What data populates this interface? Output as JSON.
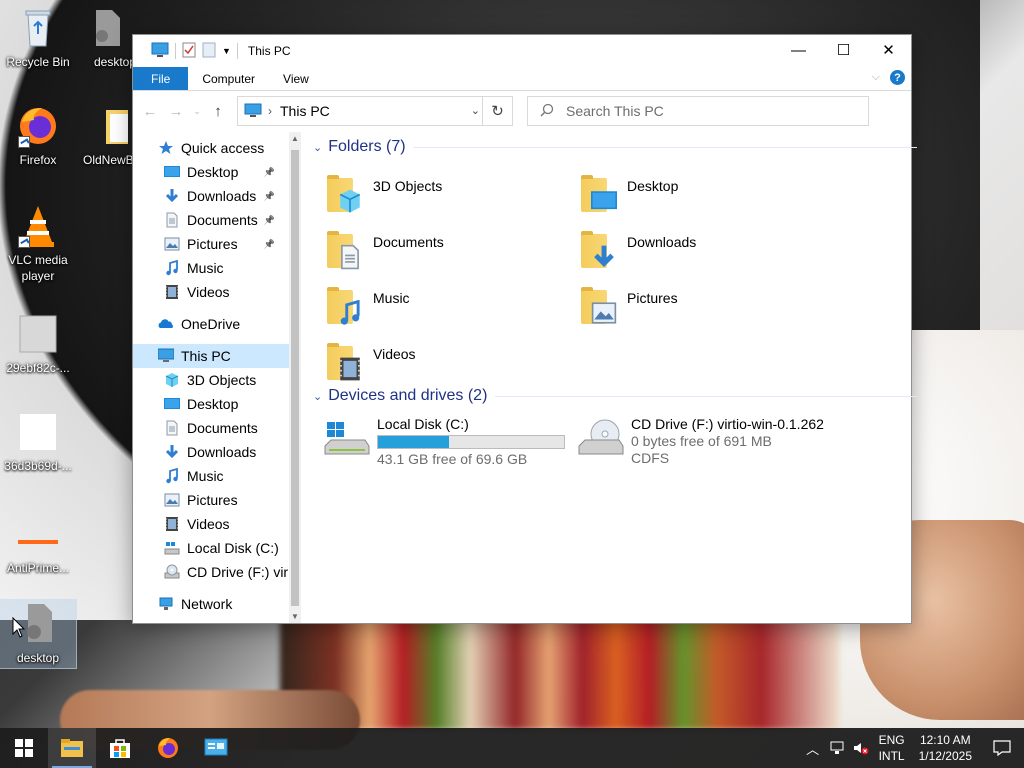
{
  "desktop": {
    "icons": [
      {
        "label": "Recycle Bin",
        "icon": "recycle-bin-icon"
      },
      {
        "label": "desktop",
        "icon": "file-icon"
      },
      {
        "label": "Firefox",
        "icon": "firefox-icon"
      },
      {
        "label": "OldNewB",
        "icon": "folder-icon"
      },
      {
        "label": "VLC media player",
        "icon": "vlc-icon"
      },
      {
        "label": "29ebf82c-...",
        "icon": "file-icon"
      },
      {
        "label": "36d3b69d-...",
        "icon": "file-icon"
      },
      {
        "label": "AntiPrime...",
        "icon": "app-icon"
      },
      {
        "label": "desktop",
        "icon": "file-icon"
      }
    ]
  },
  "window": {
    "title": "This PC",
    "controls": {
      "minimize": "—",
      "maximize": "☐",
      "close": "✕"
    },
    "ribbon_tabs": [
      "File",
      "Computer",
      "View"
    ],
    "address": {
      "location": "This PC"
    },
    "search": {
      "placeholder": "Search This PC"
    }
  },
  "nav_pane": {
    "items": [
      {
        "label": "Quick access",
        "icon": "star-icon",
        "level": 0
      },
      {
        "label": "Desktop",
        "icon": "desktop-icon",
        "level": 1,
        "pinned": true
      },
      {
        "label": "Downloads",
        "icon": "downloads-icon",
        "level": 1,
        "pinned": true
      },
      {
        "label": "Documents",
        "icon": "documents-icon",
        "level": 1,
        "pinned": true
      },
      {
        "label": "Pictures",
        "icon": "pictures-icon",
        "level": 1,
        "pinned": true
      },
      {
        "label": "Music",
        "icon": "music-icon",
        "level": 1
      },
      {
        "label": "Videos",
        "icon": "videos-icon",
        "level": 1
      },
      {
        "label": "OneDrive",
        "icon": "onedrive-icon",
        "level": 0
      },
      {
        "label": "This PC",
        "icon": "this-pc-icon",
        "level": 0,
        "selected": true
      },
      {
        "label": "3D Objects",
        "icon": "3d-objects-icon",
        "level": 1
      },
      {
        "label": "Desktop",
        "icon": "desktop-icon",
        "level": 1
      },
      {
        "label": "Documents",
        "icon": "documents-icon",
        "level": 1
      },
      {
        "label": "Downloads",
        "icon": "downloads-icon",
        "level": 1
      },
      {
        "label": "Music",
        "icon": "music-icon",
        "level": 1
      },
      {
        "label": "Pictures",
        "icon": "pictures-icon",
        "level": 1
      },
      {
        "label": "Videos",
        "icon": "videos-icon",
        "level": 1
      },
      {
        "label": "Local Disk (C:)",
        "icon": "local-disk-icon",
        "level": 1
      },
      {
        "label": "CD Drive (F:) vir",
        "icon": "cd-drive-icon",
        "level": 1
      },
      {
        "label": "Network",
        "icon": "network-icon",
        "level": 0
      }
    ]
  },
  "content": {
    "folders_header": "Folders (7)",
    "folders": [
      {
        "name": "3D Objects",
        "icon": "3d-objects-icon"
      },
      {
        "name": "Desktop",
        "icon": "desktop-icon"
      },
      {
        "name": "Documents",
        "icon": "documents-icon"
      },
      {
        "name": "Downloads",
        "icon": "downloads-icon"
      },
      {
        "name": "Music",
        "icon": "music-icon"
      },
      {
        "name": "Pictures",
        "icon": "pictures-icon"
      },
      {
        "name": "Videos",
        "icon": "videos-icon"
      }
    ],
    "devices_header": "Devices and drives (2)",
    "drives": [
      {
        "name": "Local Disk (C:)",
        "free": "43.1 GB free of 69.6 GB",
        "used_fraction": 0.38,
        "icon": "local-disk-icon"
      },
      {
        "name": "CD Drive (F:) virtio-win-0.1.262",
        "free": "0 bytes free of 691 MB",
        "fs": "CDFS",
        "icon": "cd-drive-icon"
      }
    ]
  },
  "taskbar": {
    "apps": [
      "start-icon",
      "file-explorer-icon",
      "store-icon",
      "firefox-icon",
      "control-panel-icon"
    ],
    "tray": {
      "lang_line1": "ENG",
      "lang_line2": "INTL",
      "time": "12:10 AM",
      "date": "1/12/2025"
    }
  },
  "colors": {
    "accent": "#1979ca",
    "selection": "#cce8ff",
    "progress": "#26a0da",
    "header_text": "#1e3287"
  }
}
